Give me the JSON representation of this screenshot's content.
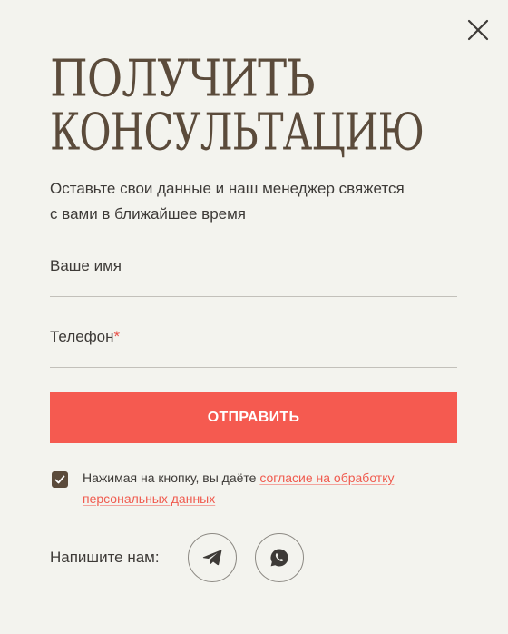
{
  "modal": {
    "title_line1": "Получить",
    "title_line2": "консультацию",
    "subtitle_line1": "Оставьте свои данные и наш менеджер свяжется",
    "subtitle_line2": "с вами в ближайшее время",
    "close_icon": "close-icon"
  },
  "form": {
    "name_label": "Ваше имя",
    "name_value": "",
    "phone_label": "Телефон",
    "phone_required_mark": "*",
    "phone_value": "",
    "submit_label": "ОТПРАВИТЬ"
  },
  "consent": {
    "checked": true,
    "text": "Нажимая на кнопку, вы даёте ",
    "link_text": "согласие на обработку персональных данных"
  },
  "contacts": {
    "label": "Напишите нам:",
    "icons": [
      "telegram-icon",
      "whatsapp-icon"
    ]
  },
  "colors": {
    "background": "#f3f3ee",
    "title": "#5b4b3b",
    "accent": "#f55a50",
    "text": "#3d3a37"
  }
}
